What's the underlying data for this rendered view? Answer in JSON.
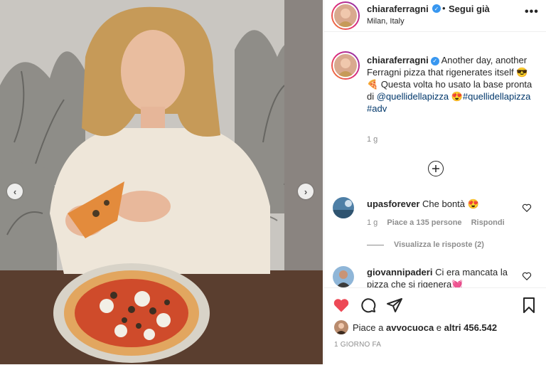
{
  "post": {
    "username": "chiaraferragni",
    "follow_label": "Segui già",
    "separator": "•",
    "location": "Milan, Italy",
    "more_icon": "more-horizontal-icon"
  },
  "caption": {
    "username": "chiaraferragni",
    "text_a": " Another day, another Ferragni pizza that rigenerates itself ",
    "emoji_a": "😎🍕",
    "text_b": " Questa volta ho usato la base pronta di ",
    "mention": "@quellidellapizza",
    "emoji_b": " 😍",
    "hashtag1": "#quellidellapizza",
    "hashtag2": "#adv",
    "time": "1 g"
  },
  "comments": [
    {
      "username": "upasforever",
      "text": " Che bontà ",
      "emoji": "😍",
      "time": "1 g",
      "likes": "Piace a 135 persone",
      "reply": "Rispondi",
      "view_replies": "Visualizza le risposte (2)"
    },
    {
      "username": "giovannipaderi",
      "text": " Ci era mancata la pizza che si rigenera",
      "emoji": "💓"
    }
  ],
  "actions": {
    "liked_by_prefix": "Piace a ",
    "liked_by_user": "avvocuoca",
    "liked_by_mid": " e ",
    "liked_by_count": "altri 456.542",
    "timestamp": "1 GIORNO FA"
  },
  "colors": {
    "like_red": "#ed4956",
    "link_blue": "#00376b",
    "verified_blue": "#3897f0"
  }
}
